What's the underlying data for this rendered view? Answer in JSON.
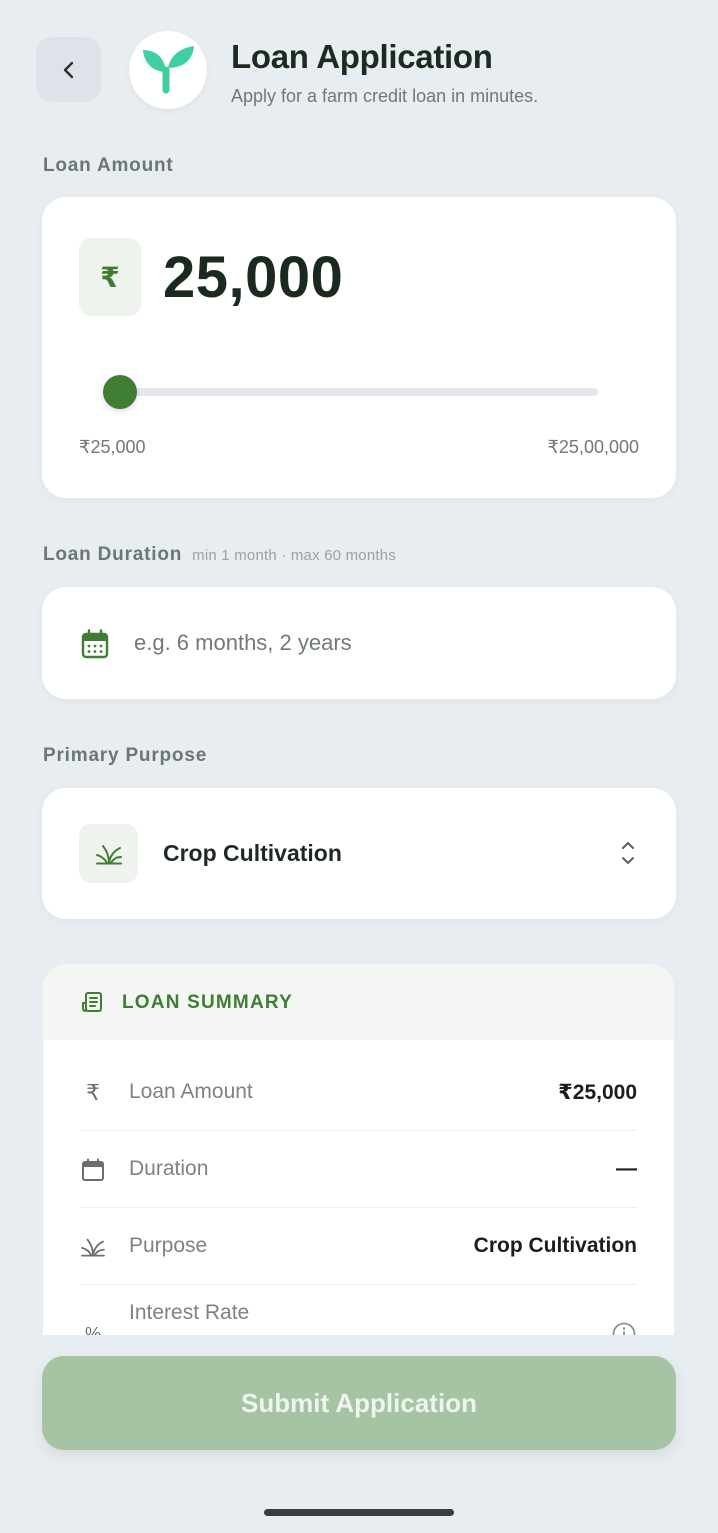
{
  "header": {
    "title": "Loan Application",
    "subtitle": "Apply for a farm credit loan in minutes."
  },
  "loan_amount": {
    "label": "Loan Amount",
    "currency_symbol": "₹",
    "value": "25,000",
    "slider_fraction": 0.0,
    "range_min": "₹25,000",
    "range_max": "₹25,00,000"
  },
  "loan_duration": {
    "label": "Loan Duration",
    "hint": "min 1 month · max 60 months",
    "value": "",
    "placeholder": "e.g. 6 months, 2 years"
  },
  "primary_purpose": {
    "label": "Primary Purpose",
    "selected": "Crop Cultivation"
  },
  "summary": {
    "title": "LOAN SUMMARY",
    "rows": [
      {
        "icon": "rupee-icon",
        "label": "Loan Amount",
        "value": "₹25,000"
      },
      {
        "icon": "calendar-icon",
        "label": "Duration",
        "value": "—"
      },
      {
        "icon": "sprout-icon",
        "label": "Purpose",
        "value": "Crop Cultivation"
      },
      {
        "icon": "percent-icon",
        "label": "Interest Rate",
        "value": ""
      }
    ]
  },
  "submit": {
    "label": "Submit Application"
  },
  "colors": {
    "background": "#e8edf1",
    "brand_green": "#3f7d34",
    "logo_teal": "#3fcfa3",
    "submit_disabled": "#a6c4a4"
  }
}
